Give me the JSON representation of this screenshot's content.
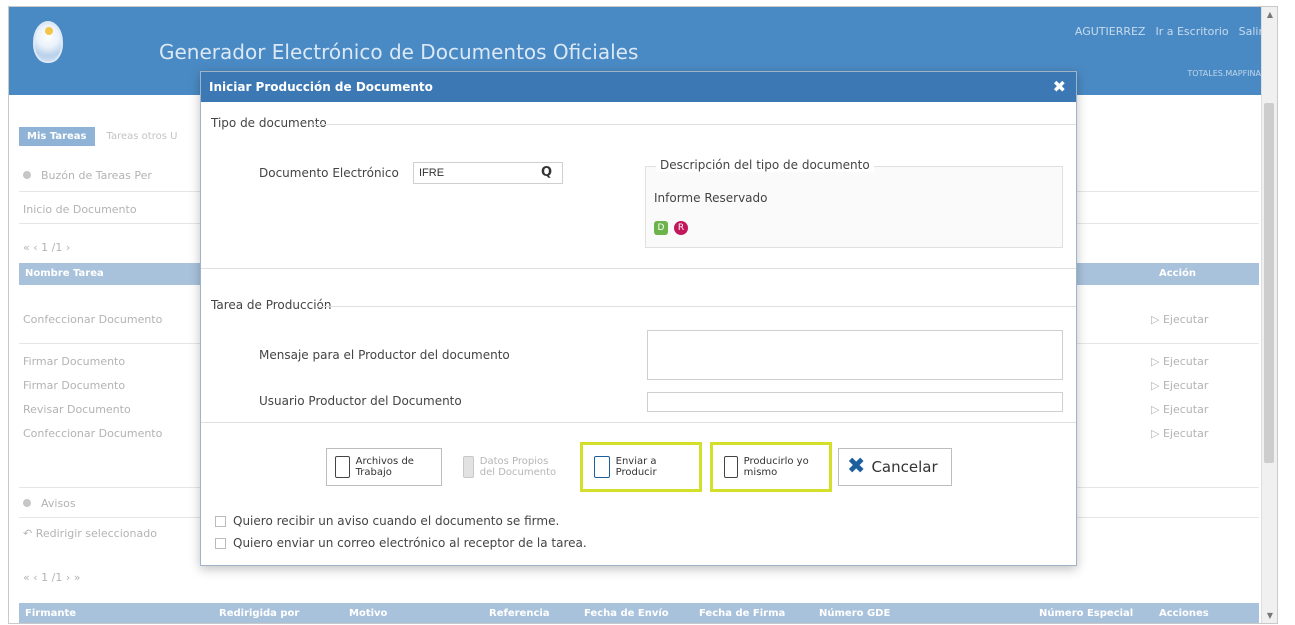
{
  "header": {
    "title": "Generador Electrónico de Documentos Oficiales",
    "user": "AGUTIERREZ",
    "desk": "Ir a Escritorio",
    "logout": "Salir",
    "sub": "TOTALES.MAPFINA"
  },
  "background": {
    "tab_active": "Mis Tareas",
    "tab_other": "Tareas otros U",
    "inbox": "Buzón de Tareas Per",
    "start_doc": "Inicio de Documento",
    "pager": "«  ‹  1     /1  ›",
    "col_task": "Nombre Tarea",
    "col_action": "Acción",
    "rows": [
      "Confeccionar Documento",
      "Firmar Documento",
      "Firmar Documento",
      "Revisar Documento",
      "Confeccionar Documento"
    ],
    "execute": "Ejecutar",
    "avisos": "Avisos",
    "redirect": "Redirigir seleccionado",
    "pager2": "«  ‹  1     /1  ›  »",
    "bottom_cols": [
      "Firmante",
      "Redirigida por",
      "Motivo",
      "Referencia",
      "Fecha de Envío",
      "Fecha de Firma",
      "Número GDE",
      "Número Especial",
      "Acciones"
    ]
  },
  "modal": {
    "title": "Iniciar Producción de Documento",
    "section1": "Tipo de documento",
    "doc_label": "Documento Electrónico",
    "doc_value": "IFRE",
    "desc_legend": "Descripción del tipo de documento",
    "desc_text": "Informe Reservado",
    "section2": "Tarea de Producción",
    "msg_label": "Mensaje para el Productor del documento",
    "user_label": "Usuario Productor del Documento",
    "buttons": {
      "archivos": "Archivos de Trabajo",
      "datos": "Datos Propios del Documento",
      "enviar": "Enviar a Producir",
      "producir": "Producirlo yo mismo",
      "cancelar": "Cancelar"
    },
    "check1": "Quiero recibir un aviso cuando el documento se firme.",
    "check2": "Quiero enviar un correo electrónico al receptor de la tarea."
  }
}
